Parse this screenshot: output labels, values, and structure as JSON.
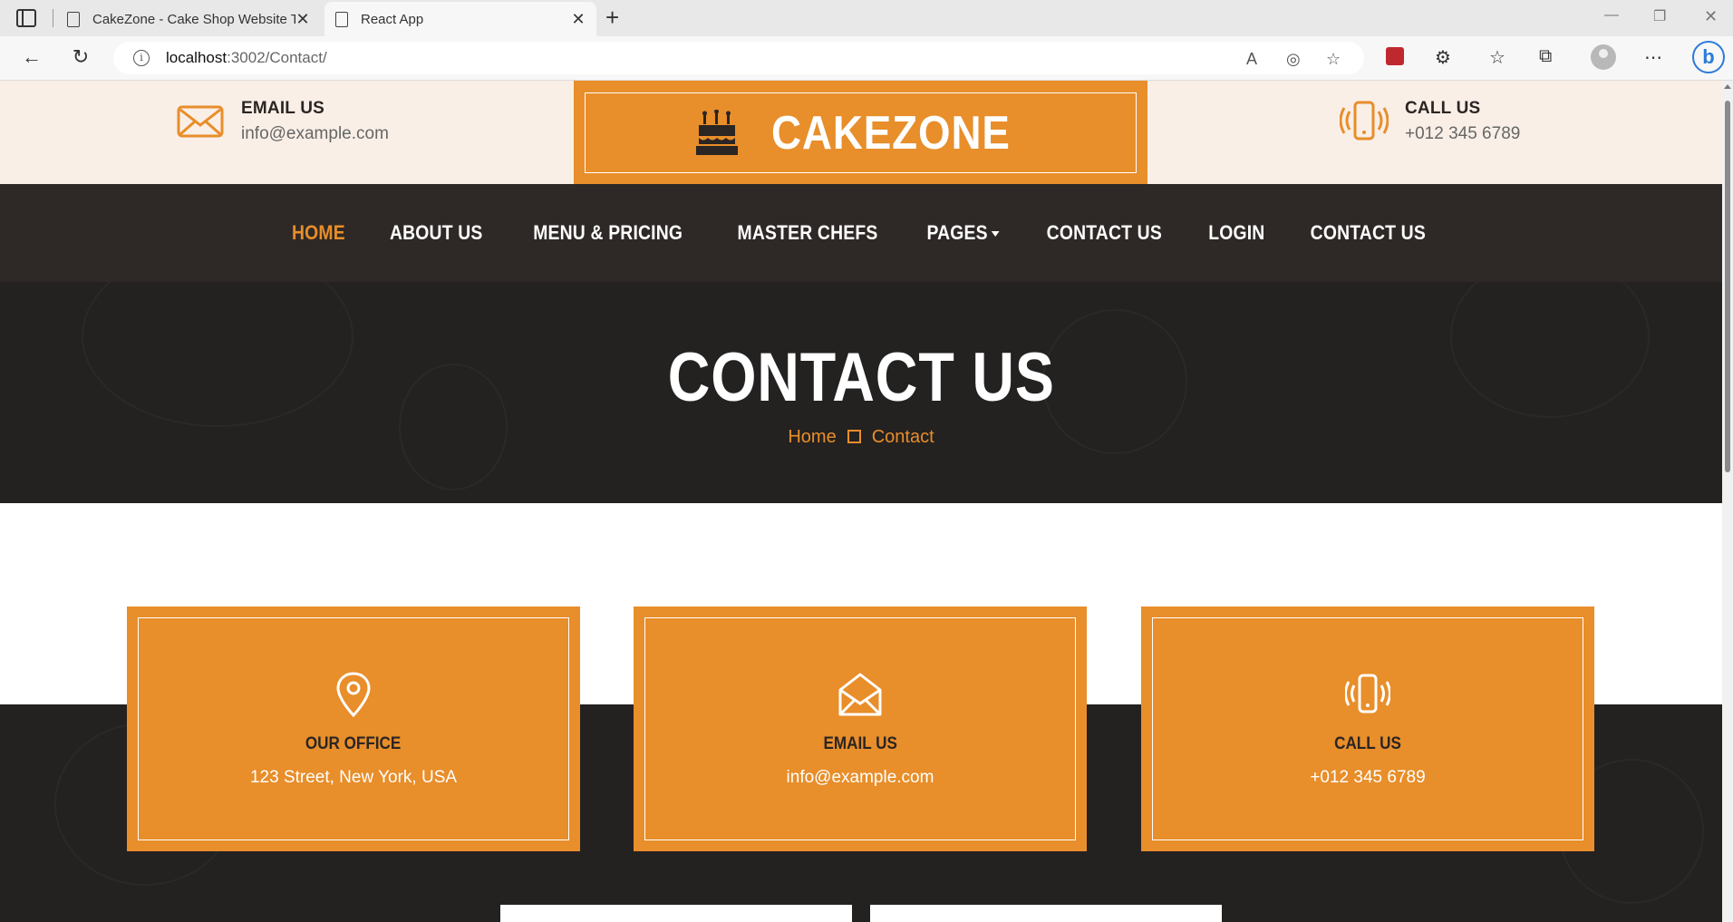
{
  "browser": {
    "tabs": [
      {
        "title": "CakeZone - Cake Shop Website T",
        "active": false
      },
      {
        "title": "React App",
        "active": true
      }
    ],
    "url_host": "localhost",
    "url_path": ":3002/Contact/"
  },
  "topbar": {
    "email": {
      "title": "EMAIL US",
      "value": "info@example.com",
      "icon": "envelope-icon"
    },
    "phone": {
      "title": "CALL US",
      "value": "+012 345 6789",
      "icon": "vibrating-phone-icon"
    }
  },
  "logo": {
    "text": "CAKEZONE",
    "icon": "birthday-cake-icon"
  },
  "nav": {
    "items": [
      {
        "label": "HOME",
        "active": true
      },
      {
        "label": "ABOUT US"
      },
      {
        "label": "MENU & PRICING"
      },
      {
        "label": "MASTER CHEFS"
      },
      {
        "label": "PAGES",
        "dropdown": true
      },
      {
        "label": "CONTACT US"
      },
      {
        "label": "LOGIN"
      },
      {
        "label": "CONTACT US"
      }
    ]
  },
  "hero": {
    "title": "CONTACT US",
    "breadcrumb": [
      "Home",
      "Contact"
    ]
  },
  "cards": [
    {
      "title": "OUR OFFICE",
      "value": "123 Street, New York, USA",
      "icon": "map-pin-icon"
    },
    {
      "title": "EMAIL US",
      "value": "info@example.com",
      "icon": "open-envelope-icon"
    },
    {
      "title": "CALL US",
      "value": "+012 345 6789",
      "icon": "vibrating-phone-icon"
    }
  ],
  "colors": {
    "accent": "#e88e2a",
    "dark": "#242121",
    "nav_bg": "#2e2926",
    "topbar_bg": "#f9efe7"
  }
}
